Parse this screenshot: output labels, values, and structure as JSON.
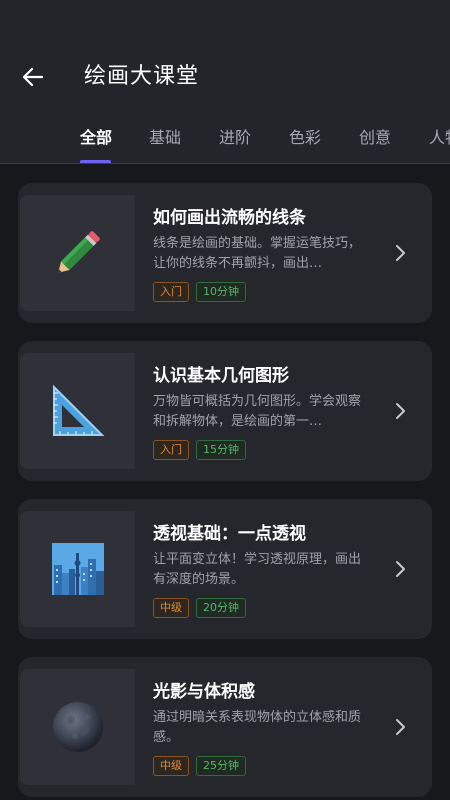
{
  "header": {
    "title": "绘画大课堂"
  },
  "tabs": [
    {
      "label": "全部",
      "active": true
    },
    {
      "label": "基础"
    },
    {
      "label": "进阶"
    },
    {
      "label": "色彩"
    },
    {
      "label": "创意"
    },
    {
      "label": "人物"
    }
  ],
  "colors": {
    "accent": "#6c63f5",
    "level_tag": "#e08a2e",
    "time_tag": "#55b86a",
    "card_bg": "#26272d"
  },
  "lessons": [
    {
      "title": "如何画出流畅的线条",
      "desc": "线条是绘画的基础。掌握运笔技巧，让你的线条不再颤抖，画出…",
      "level": "入门",
      "duration": "10分钟",
      "icon": "pencil-icon"
    },
    {
      "title": "认识基本几何图形",
      "desc": "万物皆可概括为几何图形。学会观察和拆解物体，是绘画的第一…",
      "level": "入门",
      "duration": "15分钟",
      "icon": "triangle-ruler-icon"
    },
    {
      "title": "透视基础：一点透视",
      "desc": "让平面变立体！学习透视原理，画出有深度的场景。",
      "level": "中级",
      "duration": "20分钟",
      "icon": "city-skyline-icon"
    },
    {
      "title": "光影与体积感",
      "desc": "通过明暗关系表现物体的立体感和质感。",
      "level": "中级",
      "duration": "25分钟",
      "icon": "moon-icon"
    }
  ]
}
